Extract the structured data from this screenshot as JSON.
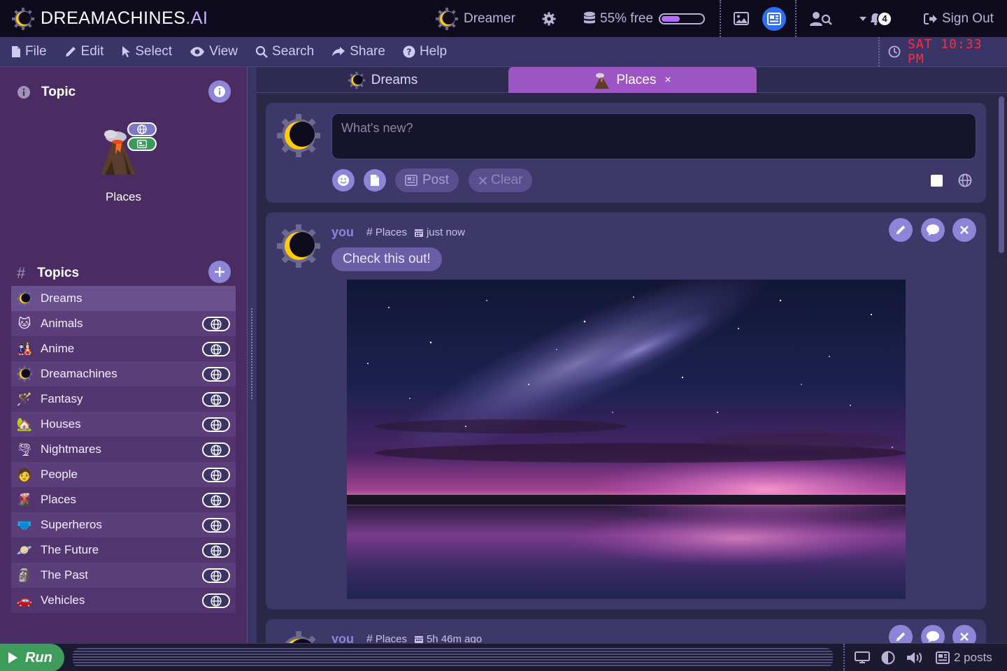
{
  "app": {
    "logo_main": "DREAMACHINES",
    "logo_suffix": ".AI",
    "user_name": "Dreamer",
    "storage_text": "55% free",
    "storage_fraction": 0.55,
    "notifications_count": "4",
    "sign_out_label": "Sign Out",
    "icons": [
      "eclipse-icon",
      "gear-icon",
      "database-icon",
      "image-icon",
      "feed-icon",
      "user-search-icon",
      "bell-icon",
      "sign-out-icon"
    ]
  },
  "menu": {
    "items": [
      "File",
      "Edit",
      "Select",
      "View",
      "Search",
      "Share",
      "Help"
    ],
    "clock": "SAT 10:33 PM"
  },
  "sidebar": {
    "topic_section_title": "Topic",
    "current_topic": "Places",
    "topics_section_title": "Topics",
    "topics": [
      {
        "label": "Dreams",
        "emoji": "eclipse",
        "shared": false
      },
      {
        "label": "Animals",
        "emoji": "🐱",
        "shared": true
      },
      {
        "label": "Anime",
        "emoji": "🎎",
        "shared": true
      },
      {
        "label": "Dreamachines",
        "emoji": "eclipse",
        "shared": true
      },
      {
        "label": "Fantasy",
        "emoji": "🪄",
        "shared": true
      },
      {
        "label": "Houses",
        "emoji": "🏡",
        "shared": true
      },
      {
        "label": "Nightmares",
        "emoji": "🌪",
        "shared": true
      },
      {
        "label": "People",
        "emoji": "🧑",
        "shared": true
      },
      {
        "label": "Places",
        "emoji": "🌋",
        "shared": true
      },
      {
        "label": "Superheros",
        "emoji": "🩲",
        "shared": true
      },
      {
        "label": "The Future",
        "emoji": "🪐",
        "shared": true
      },
      {
        "label": "The Past",
        "emoji": "🗿",
        "shared": true
      },
      {
        "label": "Vehicles",
        "emoji": "🚗",
        "shared": true
      }
    ]
  },
  "tabs": [
    {
      "label": "Dreams",
      "active": false
    },
    {
      "label": "Places",
      "active": true,
      "close": "×"
    }
  ],
  "composer": {
    "placeholder": "What's new?",
    "post_label": "Post",
    "clear_label": "Clear"
  },
  "posts": [
    {
      "user": "you",
      "topic": "Places",
      "time": "just now",
      "text": "Check this out!"
    },
    {
      "user": "you",
      "topic": "Places",
      "time": "5h 46m ago"
    }
  ],
  "statusbar": {
    "run_label": "Run",
    "posts_count": "2 posts"
  },
  "colors": {
    "accent": "#8c85d8",
    "active_tab": "#9d55c6",
    "clock": "#ff2d3d",
    "run": "#3f9d5b"
  }
}
